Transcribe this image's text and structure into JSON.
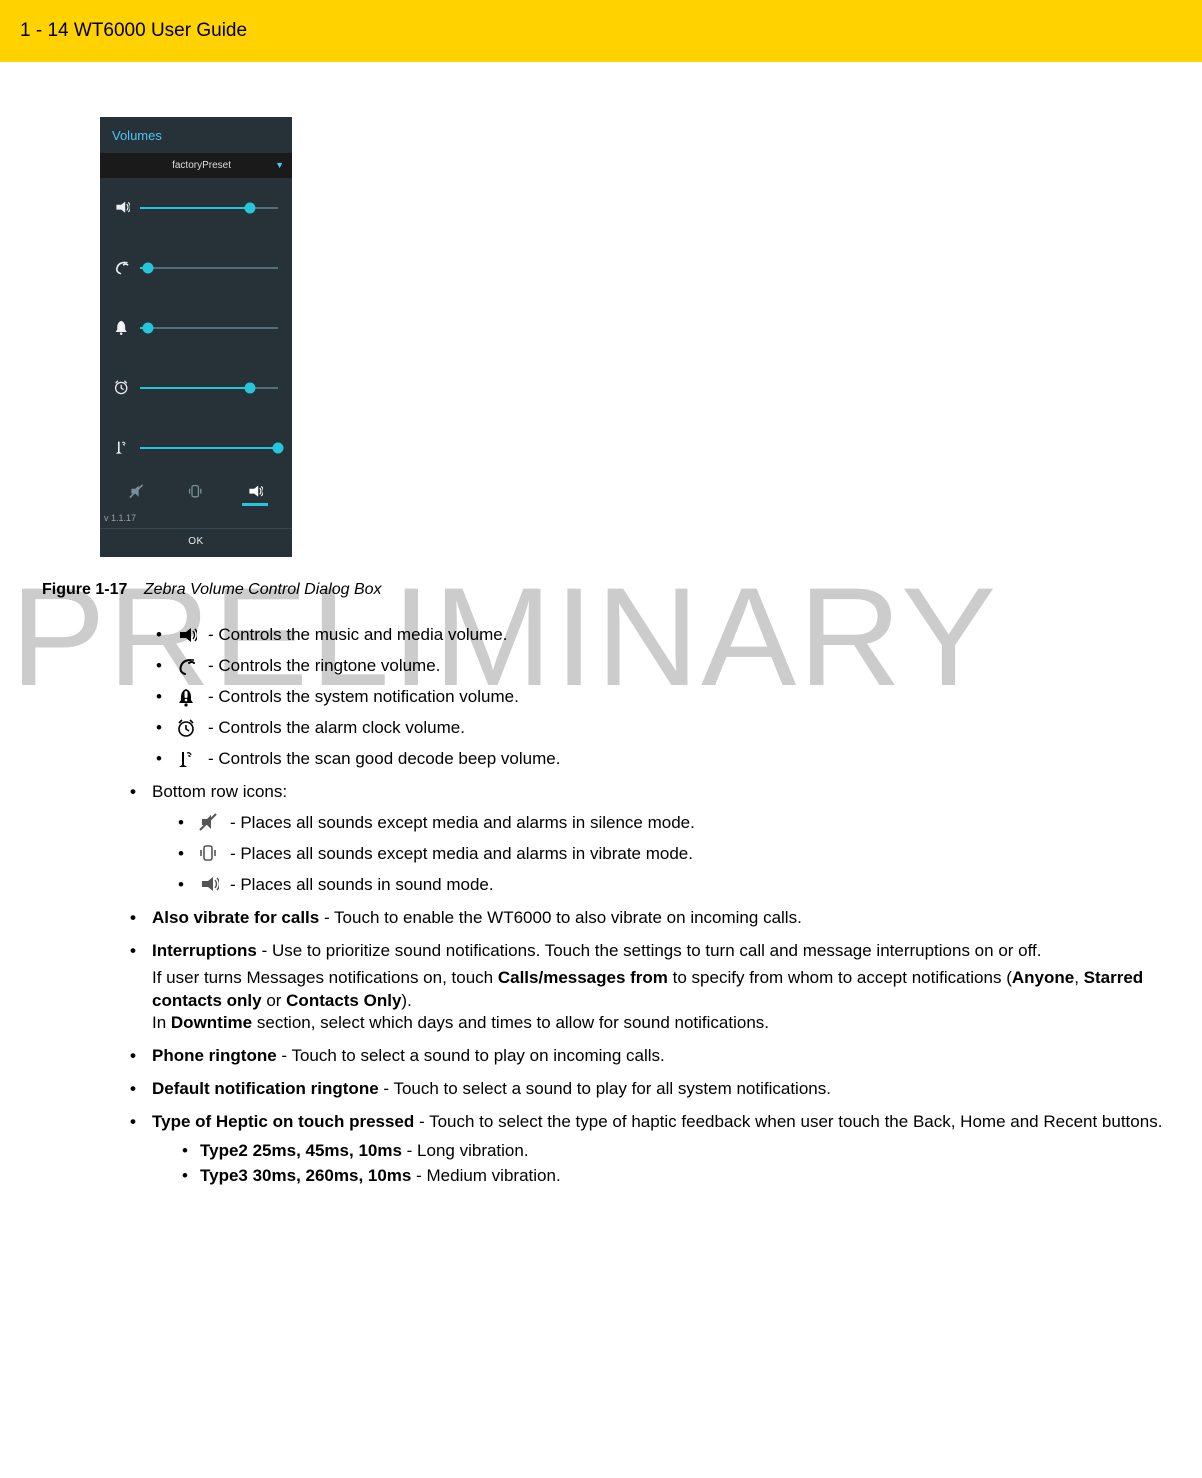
{
  "header": {
    "text": "1 - 14  WT6000 User Guide"
  },
  "watermark": "PRELIMINARY",
  "dialog": {
    "title": "Volumes",
    "preset": "factoryPreset",
    "sliders": [
      {
        "icon": "media-volume-icon",
        "value": 80
      },
      {
        "icon": "ringtone-volume-icon",
        "value": 6
      },
      {
        "icon": "notification-volume-icon",
        "value": 6
      },
      {
        "icon": "alarm-volume-icon",
        "value": 80
      },
      {
        "icon": "scan-beep-volume-icon",
        "value": 100
      }
    ],
    "bottom_icons": [
      "silence-mode-icon",
      "vibrate-mode-icon",
      "sound-mode-icon"
    ],
    "selected_mode_index": 2,
    "version": "v 1.1.17",
    "ok": "OK"
  },
  "figure": {
    "label": "Figure 1-17",
    "caption": "Zebra Volume Control Dialog Box"
  },
  "slider_descriptions": [
    {
      "icon": "media-volume-icon",
      "text": " - Controls the music and media volume."
    },
    {
      "icon": "ringtone-volume-icon",
      "text": " - Controls the ringtone volume."
    },
    {
      "icon": "notification-volume-icon",
      "text": " - Controls the system notification volume."
    },
    {
      "icon": "alarm-volume-icon",
      "text": " - Controls the alarm clock volume."
    },
    {
      "icon": "scan-beep-volume-icon",
      "text": " - Controls the scan good decode beep volume."
    }
  ],
  "bottom_row_label": "Bottom row icons:",
  "bottom_row_descriptions": [
    {
      "icon": "silence-mode-icon",
      "text": " - Places all sounds except media and alarms in silence mode."
    },
    {
      "icon": "vibrate-mode-icon",
      "text": " - Places all sounds except media and alarms in vibrate mode."
    },
    {
      "icon": "sound-mode-icon",
      "text": " - Places all sounds in sound mode."
    }
  ],
  "settings": [
    {
      "bold": "Also vibrate for calls",
      "rest": " - Touch to enable the WT6000 to also vibrate on incoming calls."
    },
    {
      "bold": "Interruptions",
      "rest": " - Use to prioritize sound notifications. Touch the settings to turn call and message interruptions on or off.",
      "extra_html": "If user turns Messages notifications on, touch <b>Calls/messages from</b> to specify from whom to accept notifications (<b>Anyone</b>, <b>Starred contacts only</b> or <b>Contacts Only</b>).<br>In <b>Downtime</b> section, select which days and times to allow for sound notifications."
    },
    {
      "bold": "Phone ringtone",
      "rest": " - Touch to select a sound to play on incoming calls."
    },
    {
      "bold": "Default notification ringtone",
      "rest": " - Touch to select a sound to play for all system notifications."
    },
    {
      "bold": "Type of Heptic on touch pressed",
      "rest": " - Touch to select the type of haptic feedback when user touch the Back, Home and Recent buttons.",
      "subitems": [
        {
          "b": "Type2 25ms, 45ms, 10ms",
          "t": " - Long vibration."
        },
        {
          "b": "Type3 30ms, 260ms, 10ms",
          "t": " - Medium vibration."
        }
      ]
    }
  ]
}
